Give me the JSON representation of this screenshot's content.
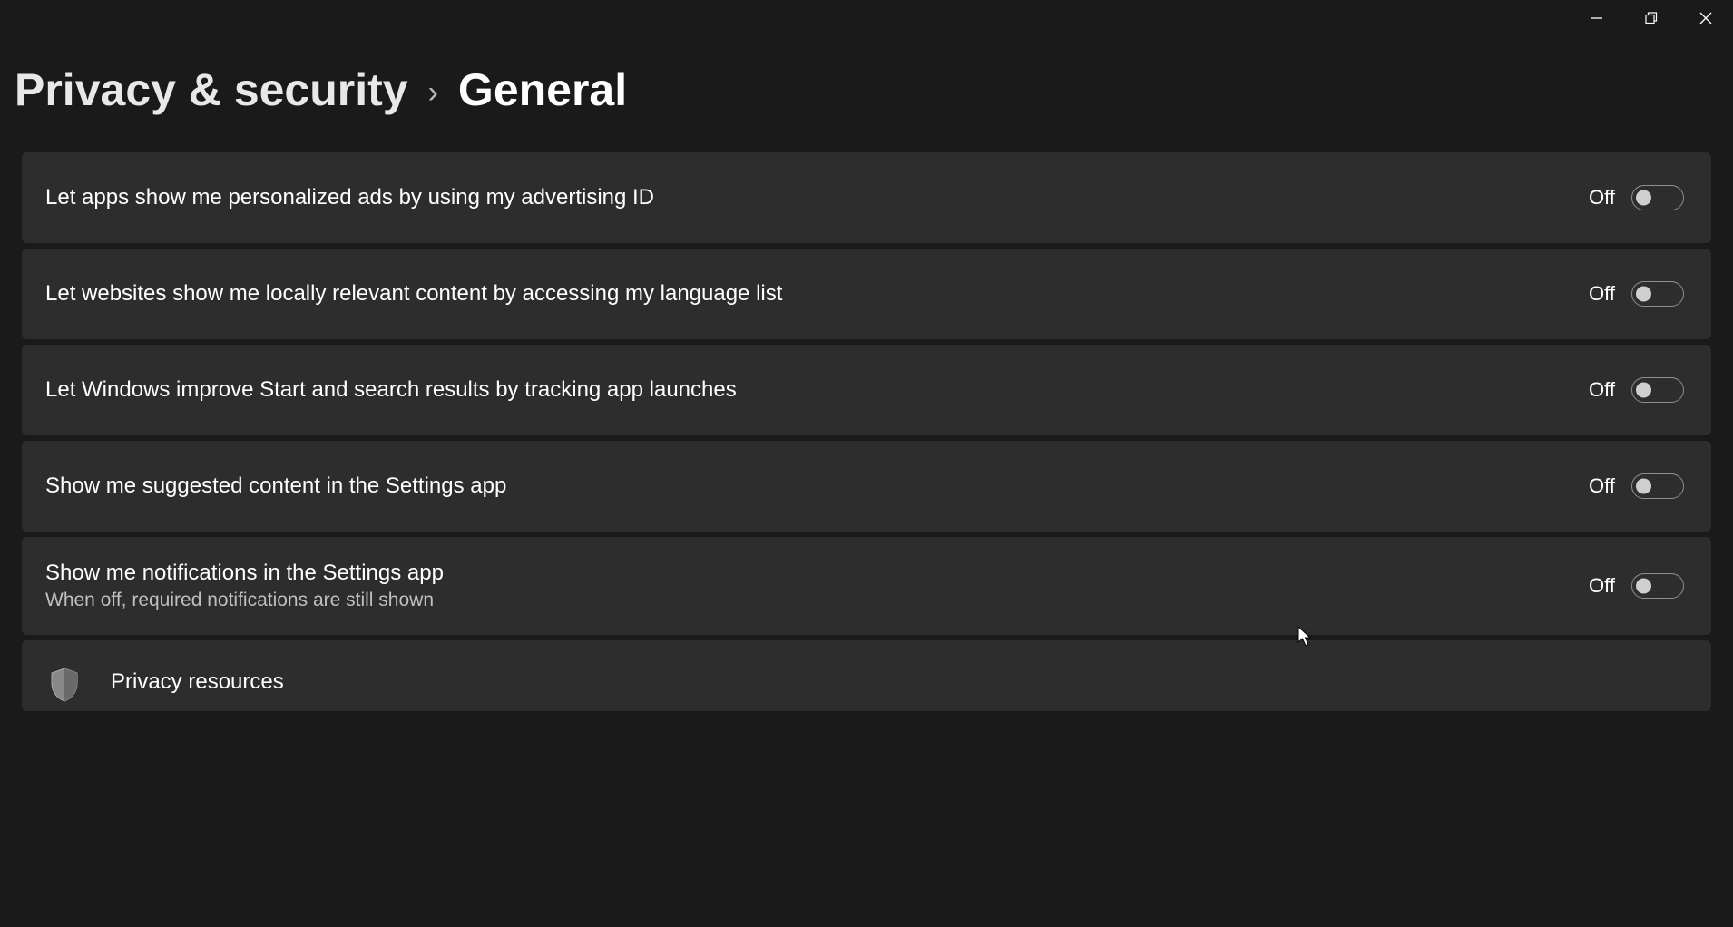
{
  "breadcrumb": {
    "parent": "Privacy & security",
    "current": "General"
  },
  "settings": [
    {
      "title": "Let apps show me personalized ads by using my advertising ID",
      "subtitle": "",
      "state": "Off"
    },
    {
      "title": "Let websites show me locally relevant content by accessing my language list",
      "subtitle": "",
      "state": "Off"
    },
    {
      "title": "Let Windows improve Start and search results by tracking app launches",
      "subtitle": "",
      "state": "Off"
    },
    {
      "title": "Show me suggested content in the Settings app",
      "subtitle": "",
      "state": "Off"
    },
    {
      "title": "Show me notifications in the Settings app",
      "subtitle": "When off, required notifications are still shown",
      "state": "Off"
    }
  ],
  "resources": {
    "title": "Privacy resources"
  }
}
